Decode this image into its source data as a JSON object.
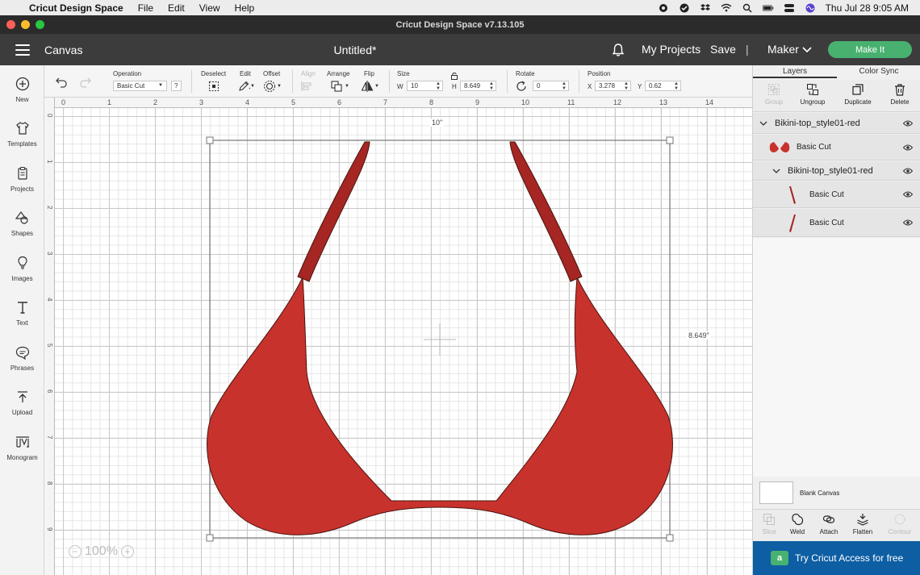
{
  "menubar": {
    "app_name": "Cricut Design Space",
    "items": [
      "File",
      "Edit",
      "View",
      "Help"
    ],
    "clock": "Thu Jul 28  9:05 AM"
  },
  "window": {
    "title": "Cricut Design Space  v7.13.105"
  },
  "header": {
    "canvas_label": "Canvas",
    "doc_title": "Untitled*",
    "my_projects": "My Projects",
    "save": "Save",
    "divider": "|",
    "machine": "Maker",
    "make_it": "Make It"
  },
  "sidebar": {
    "items": [
      {
        "label": "New",
        "icon": "plus-circle-icon"
      },
      {
        "label": "Templates",
        "icon": "shirt-icon"
      },
      {
        "label": "Projects",
        "icon": "clipboard-icon"
      },
      {
        "label": "Shapes",
        "icon": "shapes-icon"
      },
      {
        "label": "Images",
        "icon": "bulb-icon"
      },
      {
        "label": "Text",
        "icon": "text-icon"
      },
      {
        "label": "Phrases",
        "icon": "speech-bubble-icon"
      },
      {
        "label": "Upload",
        "icon": "upload-icon"
      },
      {
        "label": "Monogram",
        "icon": "monogram-icon"
      }
    ]
  },
  "toolbar": {
    "operation_label": "Operation",
    "operation_value": "Basic Cut",
    "help": "?",
    "deselect": "Deselect",
    "edit": "Edit",
    "offset": "Offset",
    "align": "Align",
    "arrange": "Arrange",
    "flip": "Flip",
    "size_label": "Size",
    "w_label": "W",
    "w_value": "10",
    "h_label": "H",
    "h_value": "8.649",
    "rotate_label": "Rotate",
    "rotate_value": "0",
    "position_label": "Position",
    "x_label": "X",
    "x_value": "3.278",
    "y_label": "Y",
    "y_value": "0.62"
  },
  "canvas": {
    "ruler_top": [
      "0",
      "1",
      "2",
      "3",
      "4",
      "5",
      "6",
      "7",
      "8",
      "9",
      "10",
      "11",
      "12",
      "13",
      "14"
    ],
    "ruler_left": [
      "0",
      "1",
      "2",
      "3",
      "4",
      "5",
      "6",
      "7",
      "8",
      "9"
    ],
    "width_label": "10\"",
    "height_label": "8.649\"",
    "zoom": "100%",
    "shape_color": "#c8322c",
    "strap_color": "#a52622"
  },
  "layers_panel": {
    "tabs": [
      "Layers",
      "Color Sync"
    ],
    "actions": [
      {
        "label": "Group",
        "enabled": false
      },
      {
        "label": "Ungroup",
        "enabled": true
      },
      {
        "label": "Duplicate",
        "enabled": true
      },
      {
        "label": "Delete",
        "enabled": true
      }
    ],
    "group_name": "Bikini-top_style01-red",
    "layer_1": "Basic Cut",
    "subgroup_name": "Bikini-top_style01-red",
    "layer_2": "Basic Cut",
    "layer_3": "Basic Cut",
    "blank_canvas": "Blank Canvas",
    "bottom_actions": [
      {
        "label": "Slice",
        "enabled": false
      },
      {
        "label": "Weld",
        "enabled": true
      },
      {
        "label": "Attach",
        "enabled": true
      },
      {
        "label": "Flatten",
        "enabled": true
      },
      {
        "label": "Contour",
        "enabled": false
      }
    ],
    "access_banner": "Try Cricut Access for free",
    "access_badge": "a"
  }
}
